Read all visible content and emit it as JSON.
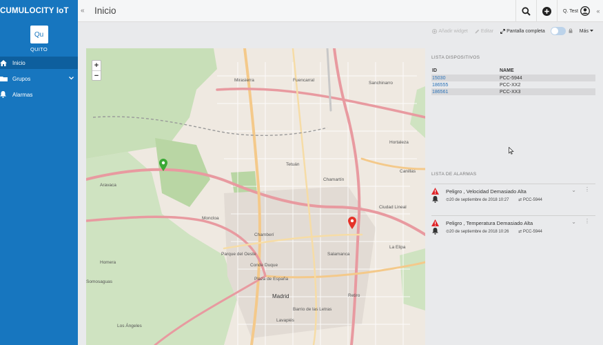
{
  "sidebar": {
    "brand": "CUMULOCITY IoT",
    "tenant_initials": "Qu",
    "tenant_name": "QUITO",
    "items": [
      {
        "label": "Inicio",
        "icon": "home-icon"
      },
      {
        "label": "Grupos",
        "icon": "folder-icon"
      },
      {
        "label": "Alarmas",
        "icon": "bell-icon"
      }
    ]
  },
  "header": {
    "title": "Inicio",
    "user": "Q. Test"
  },
  "toolbar": {
    "add_widget": "Añadir widget",
    "edit": "Editar",
    "fullscreen": "Pantalla completa",
    "more": "Más"
  },
  "map": {
    "zoom_in": "+",
    "zoom_out": "−",
    "labels": [
      "Aravaca",
      "Moncloa",
      "Tetuán",
      "Chamartín",
      "Chamberí",
      "Madrid",
      "Salamanca",
      "Retiro",
      "Lavapiés",
      "Ciudad Lineal",
      "Hortaleza",
      "Canillas",
      "Mirasierra",
      "Fuencarral",
      "Sanchinarro",
      "Homera",
      "Conde Duque",
      "Los Ángeles",
      "Somosaguas",
      "Parque del Oeste",
      "Plaza de España",
      "La Elipa",
      "Barrio de las Letras"
    ],
    "marker_colors": {
      "green": "#3aa935",
      "red": "#e5332a"
    }
  },
  "devices": {
    "title": "LISTA DISPOSITIVOS",
    "columns": [
      "ID",
      "NAME"
    ],
    "rows": [
      {
        "id": "15030",
        "name": "PCC-5944"
      },
      {
        "id": "186555",
        "name": "PCC-XX2"
      },
      {
        "id": "186561",
        "name": "PCC-XX3"
      }
    ]
  },
  "alarms": {
    "title": "LISTA DE ALARMAS",
    "items": [
      {
        "text": "Peligro , Velocidad Demasiado Alta",
        "time": "20 de septiembre de 2018 10:27",
        "device": "PCC-5944"
      },
      {
        "text": "Peligro , Temperatura Demasiado Alta",
        "time": "20 de septiembre de 2018 10:26",
        "device": "PCC-5944"
      }
    ]
  },
  "colors": {
    "sidebar": "#1776bf",
    "link": "#2a72b8",
    "alarm_red": "#e0262a"
  }
}
